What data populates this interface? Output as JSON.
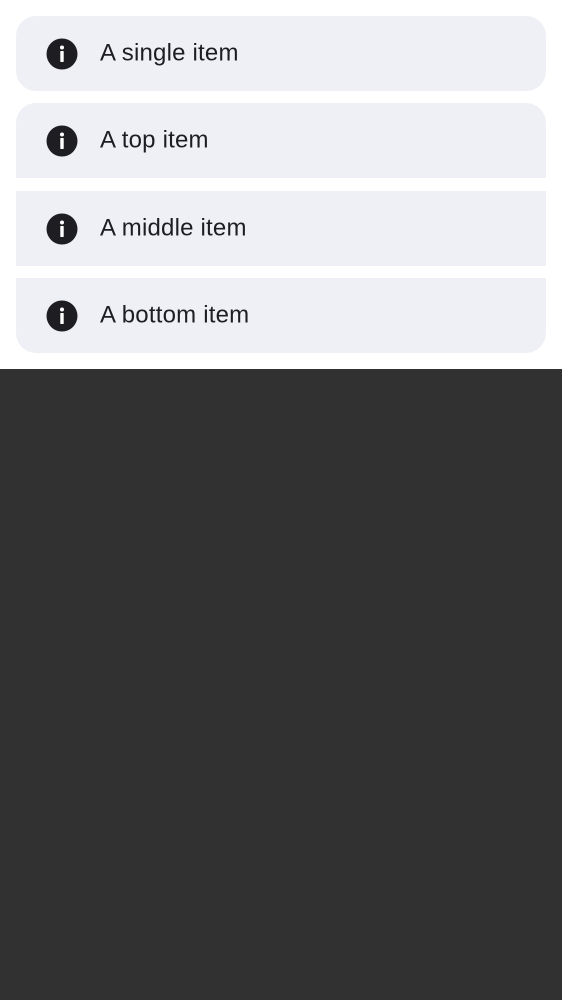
{
  "list": {
    "items": [
      {
        "label": "A single item",
        "icon": "info-icon"
      },
      {
        "label": "A top item",
        "icon": "info-icon"
      },
      {
        "label": "A middle item",
        "icon": "info-icon"
      },
      {
        "label": "A bottom item",
        "icon": "info-icon"
      }
    ]
  },
  "colors": {
    "item_background": "#eff0f5",
    "page_background": "#ffffff",
    "lower_area": "#313131",
    "icon": "#1d1d22",
    "text": "#1d1d22"
  }
}
